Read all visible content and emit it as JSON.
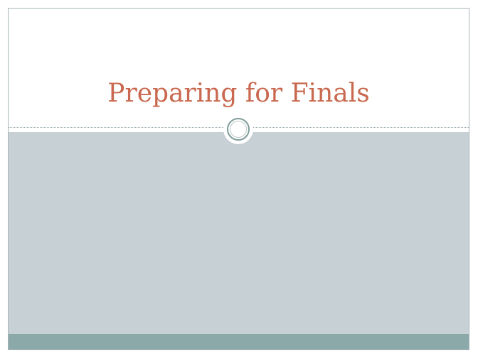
{
  "slide": {
    "title": "Preparing for Finals",
    "colors": {
      "title": "#c9694f",
      "content_panel": "#c6d0d5",
      "footer_band": "#8ca9a9",
      "ornament_ring": "#7e9c99"
    }
  }
}
